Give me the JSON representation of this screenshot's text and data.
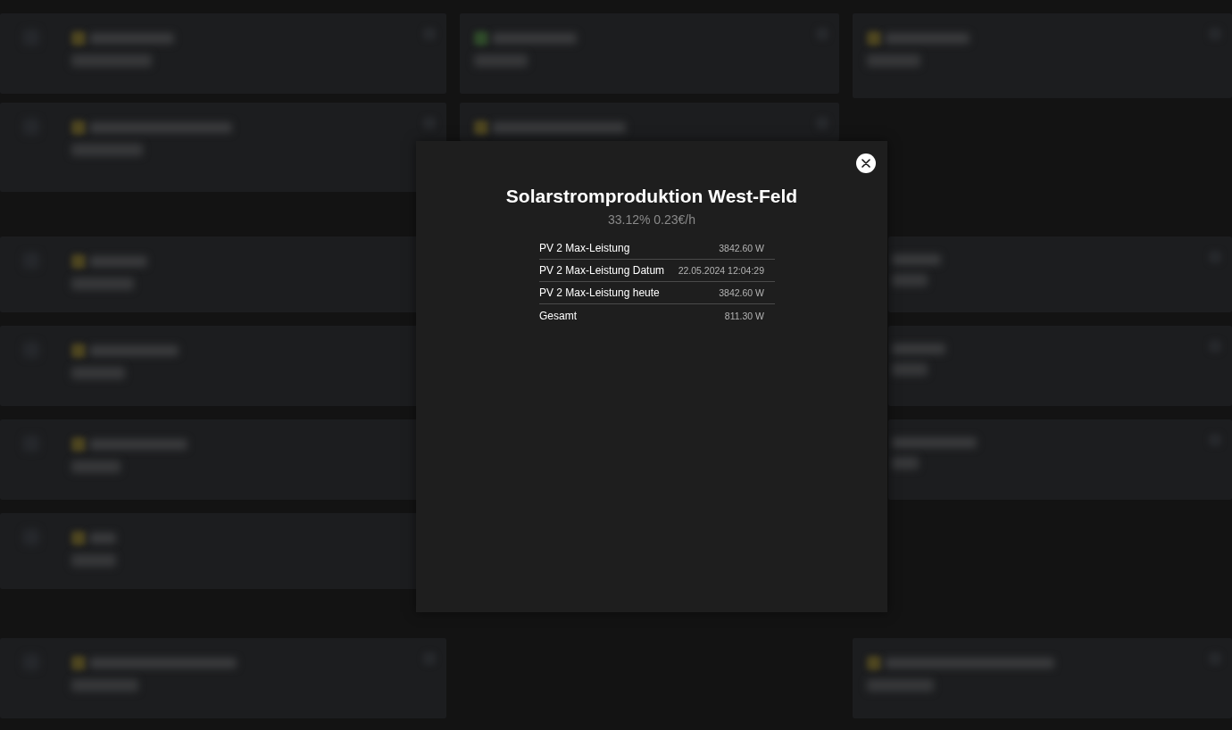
{
  "modal": {
    "title": "Solarstromproduktion West-Feld",
    "subtitle": "33.12% 0.23€/h",
    "rows": [
      {
        "label": "PV 2 Max-Leistung",
        "value": "3842.60 W"
      },
      {
        "label": "PV 2 Max-Leistung Datum",
        "value": "22.05.2024 12:04:29"
      },
      {
        "label": "PV 2 Max-Leistung heute",
        "value": "3842.60 W"
      },
      {
        "label": "Gesamt",
        "value": "811.30 W"
      }
    ]
  }
}
